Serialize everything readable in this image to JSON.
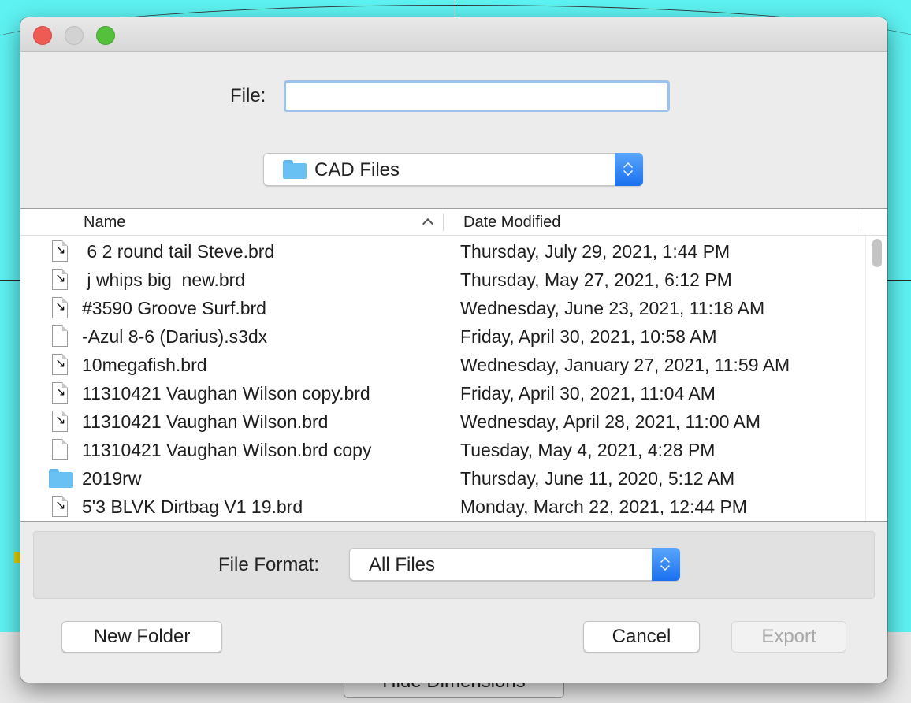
{
  "background": {
    "hidden_button_label": "Hide Dimensions"
  },
  "dialog": {
    "file_label": "File:",
    "file_value": "",
    "location": "CAD Files",
    "columns": {
      "name": "Name",
      "date": "Date Modified"
    },
    "files": [
      {
        "name": " 6 2 round tail Steve.brd",
        "date": "Thursday, July 29, 2021, 1:44 PM",
        "icon": "brd-file-icon"
      },
      {
        "name": " j whips big  new.brd",
        "date": "Thursday, May 27, 2021, 6:12 PM",
        "icon": "brd-file-icon"
      },
      {
        "name": "#3590 Groove Surf.brd",
        "date": "Wednesday, June 23, 2021, 11:18 AM",
        "icon": "brd-file-icon"
      },
      {
        "name": "-Azul 8-6 (Darius).s3dx",
        "date": "Friday, April 30, 2021, 10:58 AM",
        "icon": "generic-file-icon"
      },
      {
        "name": "10megafish.brd",
        "date": "Wednesday, January 27, 2021, 11:59 AM",
        "icon": "brd-file-icon"
      },
      {
        "name": "11310421 Vaughan Wilson copy.brd",
        "date": "Friday, April 30, 2021, 11:04 AM",
        "icon": "brd-file-icon"
      },
      {
        "name": "11310421 Vaughan Wilson.brd",
        "date": "Wednesday, April 28, 2021, 11:00 AM",
        "icon": "brd-file-icon"
      },
      {
        "name": "11310421 Vaughan Wilson.brd copy",
        "date": "Tuesday, May 4, 2021, 4:28 PM",
        "icon": "generic-file-icon"
      },
      {
        "name": "2019rw",
        "date": "Thursday, June 11, 2020, 5:12 AM",
        "icon": "folder-icon"
      },
      {
        "name": "5'3 BLVK Dirtbag V1 19.brd",
        "date": "Monday, March 22, 2021, 12:44 PM",
        "icon": "brd-file-icon"
      }
    ],
    "format_label": "File Format:",
    "format_value": "All Files",
    "buttons": {
      "new_folder": "New Folder",
      "cancel": "Cancel",
      "export": "Export"
    }
  }
}
